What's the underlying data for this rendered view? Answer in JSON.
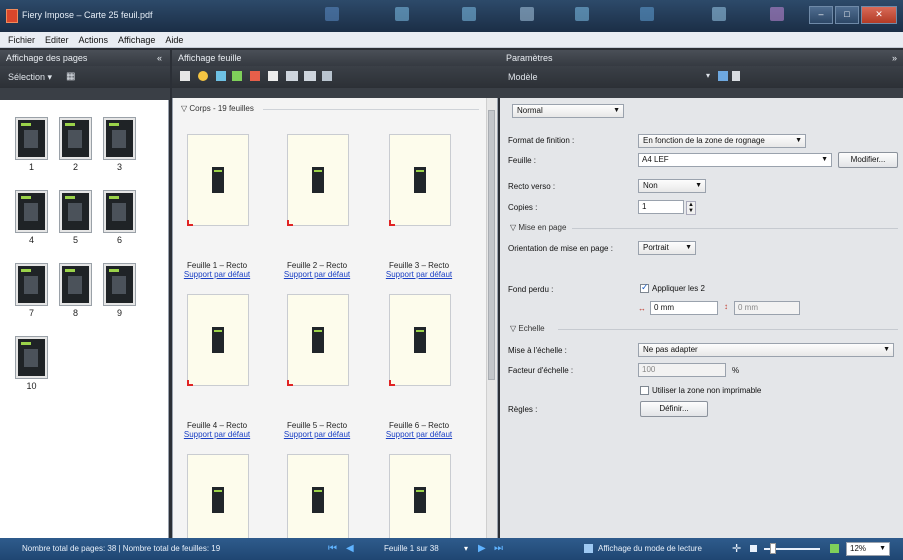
{
  "window": {
    "title": "Fiery Impose – Carte 25 feuil.pdf"
  },
  "menu": [
    "Fichier",
    "Editer",
    "Actions",
    "Affichage",
    "Aide"
  ],
  "pages_panel": {
    "title": "Affichage des pages",
    "close": "«",
    "tool_label": "Sélection ▾",
    "thumbs": [
      "1",
      "2",
      "3",
      "4",
      "5",
      "6",
      "7",
      "8",
      "9",
      "10"
    ]
  },
  "sheets_panel": {
    "title": "Affichage feuille",
    "group": "Corps - 19 feuilles",
    "sheets": [
      {
        "label": "Feuille 1 – Recto",
        "link": "Support par défaut"
      },
      {
        "label": "Feuille 2 – Recto",
        "link": "Support par défaut"
      },
      {
        "label": "Feuille 3 – Recto",
        "link": "Support par défaut"
      },
      {
        "label": "Feuille 4 – Recto",
        "link": "Support par défaut"
      },
      {
        "label": "Feuille 5 – Recto",
        "link": "Support par défaut"
      },
      {
        "label": "Feuille 6 – Recto",
        "link": "Support par défaut"
      }
    ]
  },
  "params": {
    "title": "Paramètres",
    "collapse": "»",
    "model_label": "Modèle",
    "model_value": "Normal",
    "finish_label": "Format de finition :",
    "finish_value": "En fonction de la zone de rognage",
    "sheet_label": "Feuille :",
    "sheet_value": "A4 LEF",
    "modify_button": "Modifier...",
    "duplex_label": "Recto verso :",
    "duplex_value": "Non",
    "copies_label": "Copies :",
    "copies_value": "1",
    "layout_section": "Mise en page",
    "orientation_label": "Orientation de mise en page :",
    "orientation_value": "Portrait",
    "bleed_label": "Fond perdu :",
    "bleed_apply": "Appliquer les 2",
    "bleed_x": "0 mm",
    "bleed_y": "0 mm",
    "scale_section": "Echelle",
    "scale_mode_label": "Mise à l'échelle :",
    "scale_mode_value": "Ne pas adapter",
    "scale_factor_label": "Facteur d'échelle :",
    "scale_factor_value": "100",
    "scale_unit": "%",
    "printable_area": "Utiliser la zone non imprimable",
    "rules_label": "Règles :",
    "rules_button": "Définir..."
  },
  "status": {
    "totals": "Nombre total de pages: 38 | Nombre total de feuilles: 19",
    "sheet_nav": "Feuille 1 sur 38",
    "reading_mode": "Affichage du mode de lecture",
    "zoom": "12%"
  }
}
